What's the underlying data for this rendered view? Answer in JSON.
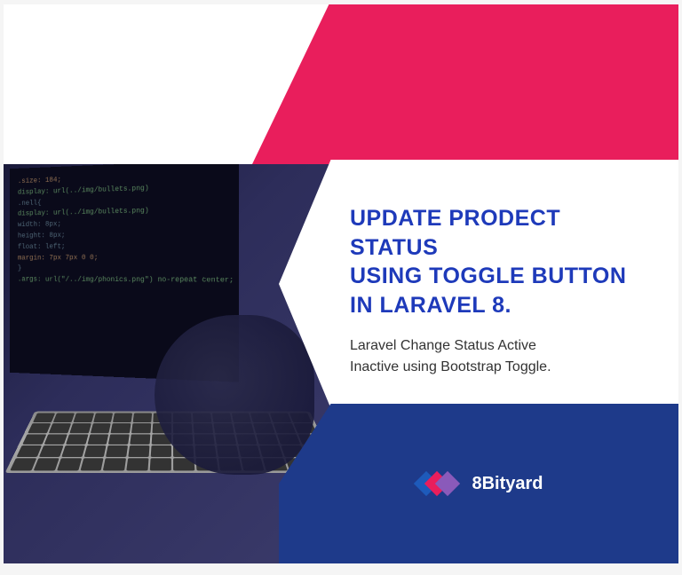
{
  "title_line1": "UPDATE PRODECT STATUS",
  "title_line2": "USING TOGGLE BUTTON",
  "title_line3": "IN LARAVEL 8.",
  "subtitle_line1": "Laravel Change Status Active",
  "subtitle_line2": "Inactive using Bootstrap Toggle.",
  "brand": "8Bityard",
  "code_lines": [
    ".size: 184;",
    "display: url(../img/bullets.png)",
    ".nell{",
    "display: url(../img/bullets.png)",
    "width: 8px;",
    "height: 8px;",
    "float: left;",
    "margin: 7px 7px 0 0;",
    "}",
    "",
    ".args: url(\"/../img/phonics.png\") no-repeat center;"
  ],
  "colors": {
    "pink": "#e91e5c",
    "blue": "#1e3a8a",
    "title_blue": "#1e3aba"
  }
}
